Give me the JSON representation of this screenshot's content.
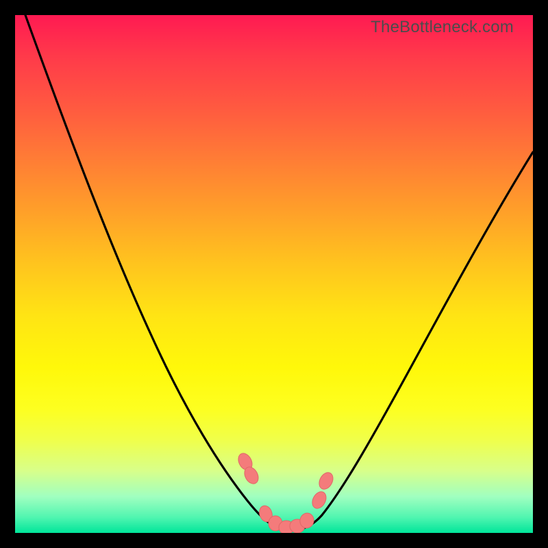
{
  "watermark": "TheBottleneck.com",
  "chart_data": {
    "type": "line",
    "title": "",
    "xlabel": "",
    "ylabel": "",
    "xlim": [
      0,
      100
    ],
    "ylim": [
      0,
      100
    ],
    "background": "rainbow-gradient vertical (red top to green bottom)",
    "series": [
      {
        "name": "bottleneck-curve",
        "color": "#000000",
        "x": [
          2,
          6,
          10,
          14,
          18,
          22,
          26,
          30,
          34,
          38,
          42,
          46,
          48,
          50,
          52,
          54,
          56,
          58,
          62,
          66,
          70,
          74,
          78,
          82,
          86,
          90,
          94,
          98
        ],
        "y": [
          100,
          93,
          86,
          79,
          71,
          63,
          55,
          47,
          39,
          30,
          20,
          10,
          5,
          2,
          0,
          0,
          2,
          5,
          12,
          20,
          28,
          35,
          42,
          48,
          54,
          59,
          64,
          68
        ]
      }
    ],
    "markers": {
      "name": "highlight-points",
      "color": "#f47b7b",
      "shape": "rounded-bead",
      "x": [
        44.5,
        45.5,
        48,
        50,
        52,
        54,
        56,
        57.5,
        58.5
      ],
      "y": [
        14,
        11,
        3,
        1,
        0.5,
        0.5,
        1,
        6,
        10
      ]
    }
  }
}
